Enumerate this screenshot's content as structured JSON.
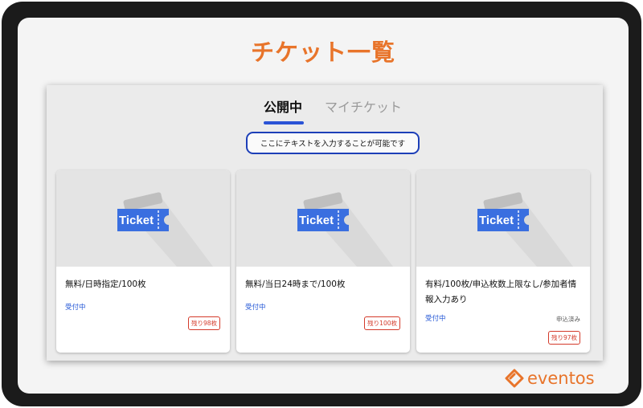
{
  "page": {
    "title": "チケット一覧"
  },
  "tabs": [
    {
      "label": "公開中",
      "active": true
    },
    {
      "label": "マイチケット",
      "active": false
    }
  ],
  "notice": {
    "text": "ここにテキストを入力することが可能です"
  },
  "ticket_icon": {
    "label": "Ticket",
    "color": "#3a6fe0"
  },
  "cards": [
    {
      "title": "無料/日時指定/100枚",
      "status": "受付中",
      "remaining": "残り98枚",
      "applied": ""
    },
    {
      "title": "無料/当日24時まで/100枚",
      "status": "受付中",
      "remaining": "残り100枚",
      "applied": ""
    },
    {
      "title": "有料/100枚/申込枚数上限なし/参加者情報入力あり",
      "status": "受付中",
      "remaining": "残り97枚",
      "applied": "申込済み"
    }
  ],
  "brand": {
    "name": "eventos",
    "color": "#e8742a"
  },
  "colors": {
    "accent": "#2a53d6",
    "title": "#e8742a",
    "badge": "#d43a2a"
  }
}
